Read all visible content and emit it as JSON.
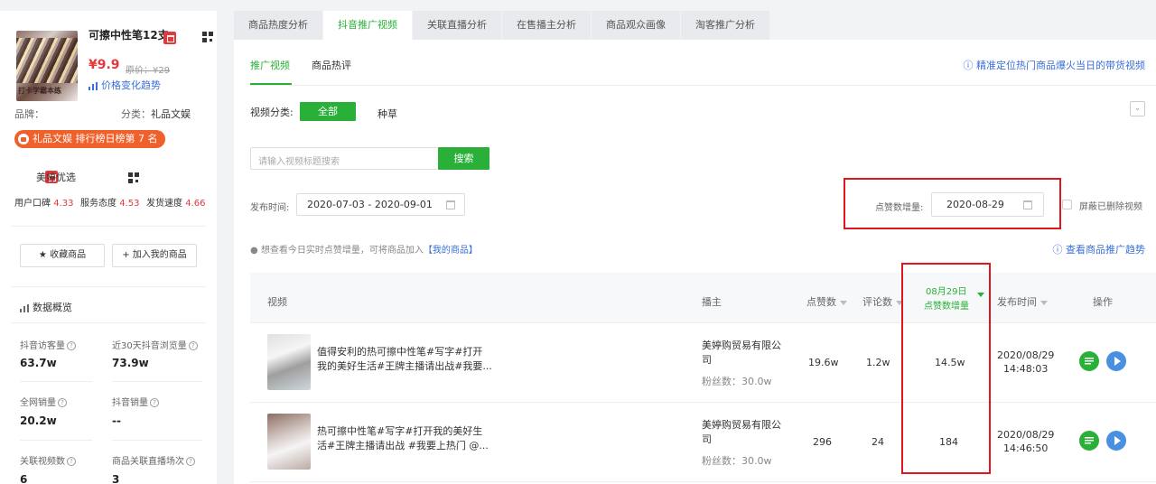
{
  "product": {
    "name": "可擦中性笔12支",
    "thumb_caption": "打卡学霸本练",
    "price": "¥9.9",
    "original_price": "原价：¥29",
    "price_trend": "价格变化趋势",
    "brand_label": "品牌：",
    "brand_value": "",
    "category_label": "分类：",
    "category_value": "礼品文娱",
    "rank_badge": "礼品文娱 排行榜日榜第 7 名"
  },
  "shop": {
    "name": "美婷优选",
    "word_of_mouth_label": "用户口碑",
    "word_of_mouth": "4.33",
    "service_label": "服务态度",
    "service": "4.53",
    "delivery_label": "发货速度",
    "delivery": "4.66"
  },
  "actions": {
    "favorite": "收藏商品",
    "add_mine": "加入我的商品"
  },
  "overview": {
    "title": "数据概览",
    "stats": [
      {
        "label": "抖音访客量",
        "value": "63.7w"
      },
      {
        "label": "近30天抖音浏览量",
        "value": "73.9w"
      },
      {
        "label": "全网销量",
        "value": "20.2w"
      },
      {
        "label": "抖音销量",
        "value": "--"
      },
      {
        "label": "关联视频数",
        "value": "6"
      },
      {
        "label": "商品关联直播场次",
        "value": "3"
      }
    ]
  },
  "tabs": [
    "商品热度分析",
    "抖音推广视频",
    "关联直播分析",
    "在售播主分析",
    "商品观众画像",
    "淘客推广分析"
  ],
  "subtabs": [
    "推广视频",
    "商品热评"
  ],
  "help_top": "精准定位热门商品爆火当日的带货视频",
  "filters": {
    "category_label": "视频分类:",
    "category_all": "全部",
    "category_grass": "种草",
    "search_placeholder": "请输入视频标题搜索",
    "search_button": "搜索",
    "publish_label": "发布时间:",
    "publish_range": "2020-07-03 - 2020-09-01",
    "likes_inc_label": "点赞数增量:",
    "likes_inc_date": "2020-08-29",
    "hide_deleted": "屏蔽已删除视频"
  },
  "notice": {
    "text": "想查看今日实时点赞增量，可将商品加入",
    "link": "【我的商品】",
    "trend_link": "查看商品推广趋势"
  },
  "table": {
    "headers": {
      "video": "视频",
      "anchor": "播主",
      "likes": "点赞数",
      "comments": "评论数",
      "inc_date": "08月29日",
      "inc_label": "点赞数增量",
      "publish": "发布时间",
      "ops": "操作"
    },
    "rows": [
      {
        "title_line1": "值得安利的热可擦中性笔#写字#打开",
        "title_line2": "我的美好生活#王牌主播请出战#我要...",
        "anchor_line1": "美婷购贸易有限公",
        "anchor_line2": "司",
        "fans": "粉丝数：30.0w",
        "likes": "19.6w",
        "comments": "1.2w",
        "inc": "14.5w",
        "date": "2020/08/29",
        "time": "14:48:03"
      },
      {
        "title_line1": "热可擦中性笔#写字#打开我的美好生",
        "title_line2": "活#王牌主播请出战 #我要上热门 @...",
        "anchor_line1": "美婷购贸易有限公",
        "anchor_line2": "司",
        "fans": "粉丝数：30.0w",
        "likes": "296",
        "comments": "24",
        "inc": "184",
        "date": "2020/08/29",
        "time": "14:46:50"
      }
    ]
  }
}
